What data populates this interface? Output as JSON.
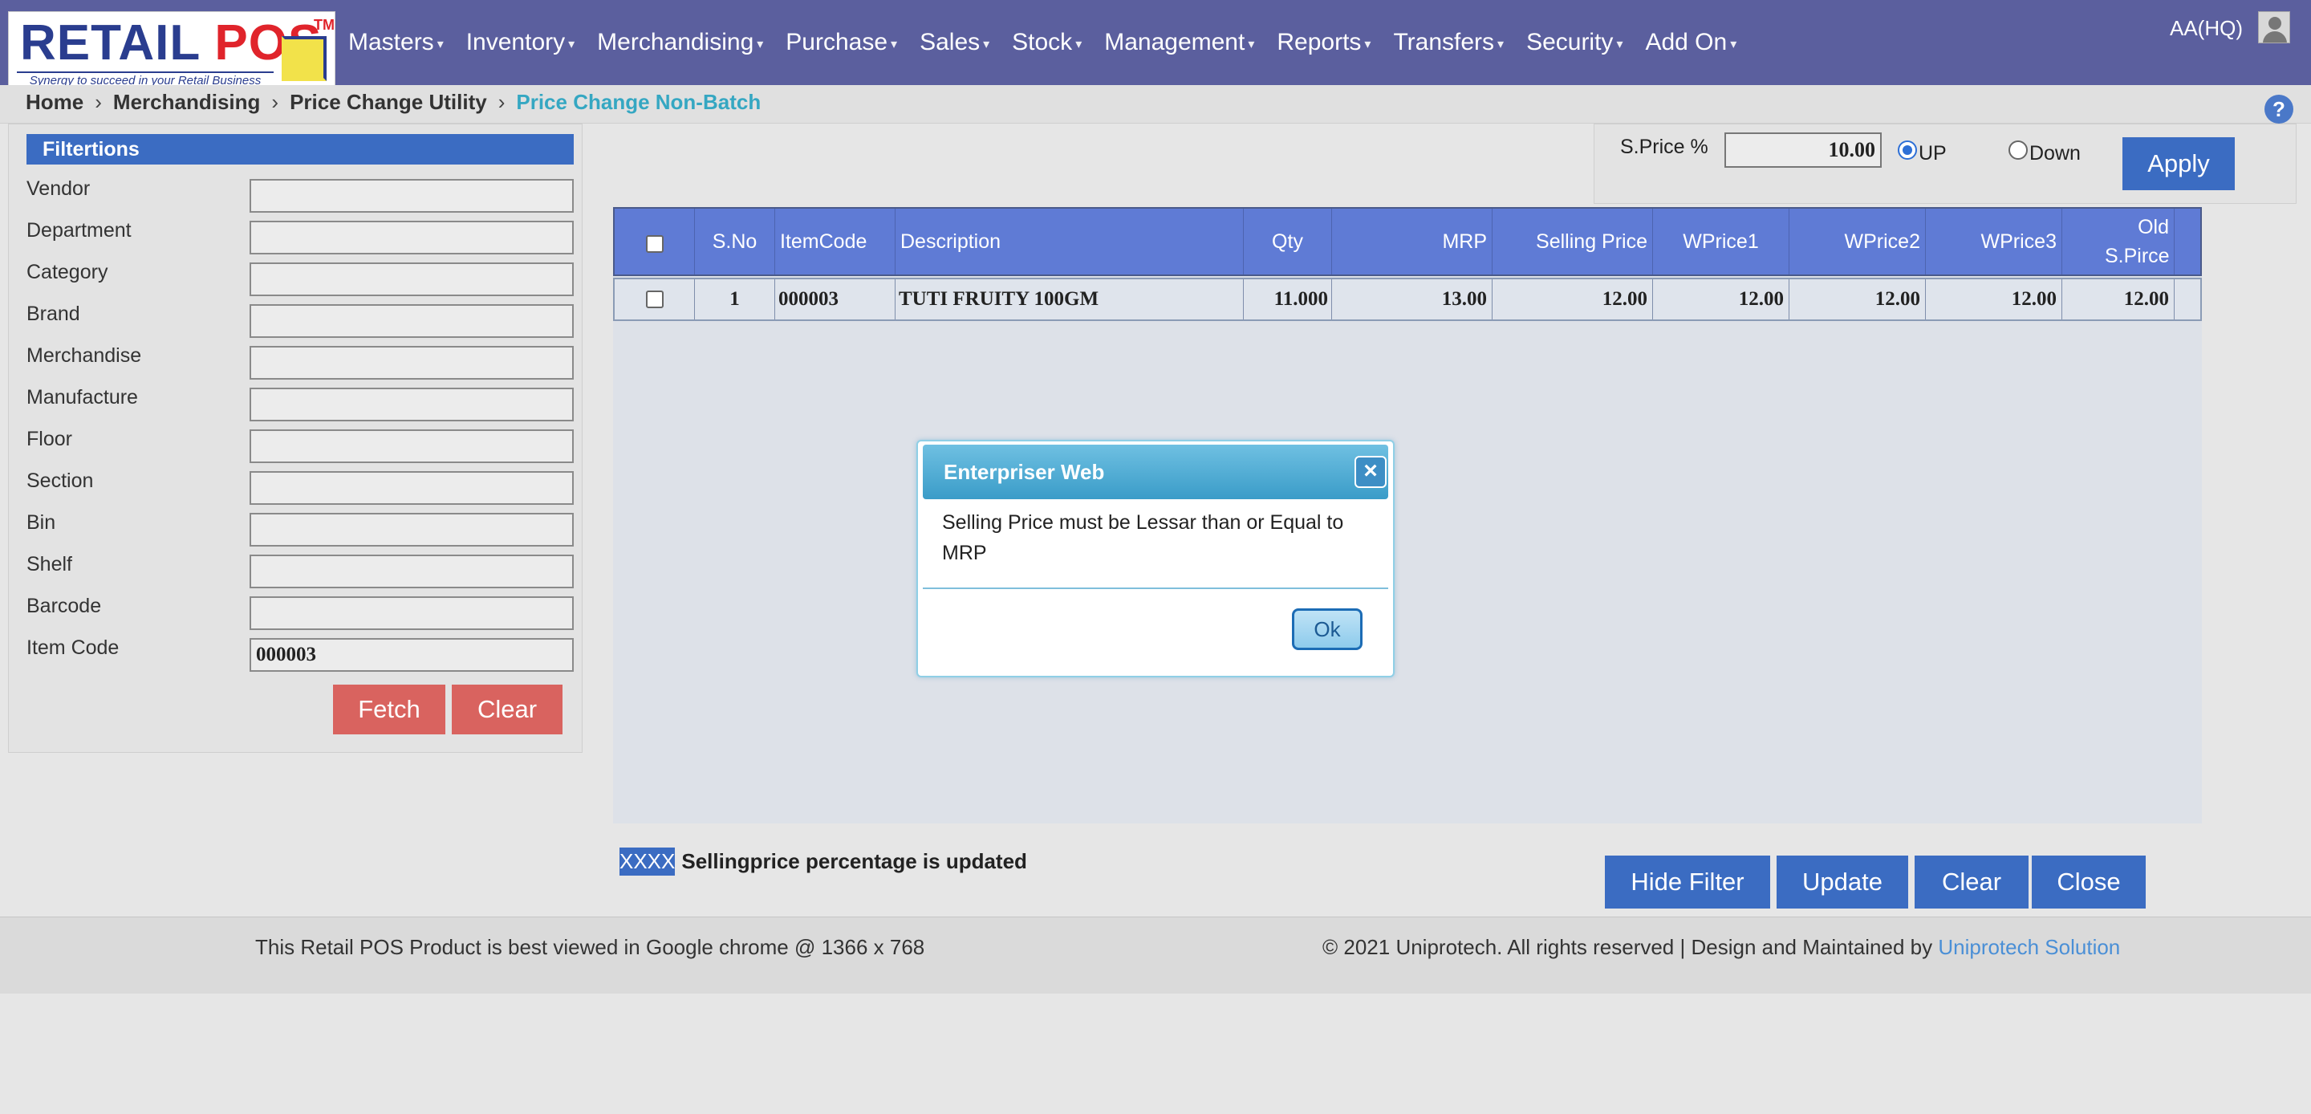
{
  "logo": {
    "text_part1": "RETAIL",
    "text_part2": "POS",
    "tm": "TM",
    "tagline": "Synergy to succeed in your Retail Business"
  },
  "nav": {
    "items": [
      "Masters",
      "Inventory",
      "Merchandising",
      "Purchase",
      "Sales",
      "Stock",
      "Management",
      "Reports",
      "Transfers",
      "Security",
      "Add On"
    ],
    "user": "AA(HQ)"
  },
  "breadcrumb": {
    "items": [
      "Home",
      "Merchandising",
      "Price Change Utility"
    ],
    "active": "Price Change Non-Batch"
  },
  "filters": {
    "title": "Filtertions",
    "fields": [
      {
        "label": "Vendor",
        "value": ""
      },
      {
        "label": "Department",
        "value": ""
      },
      {
        "label": "Category",
        "value": ""
      },
      {
        "label": "Brand",
        "value": ""
      },
      {
        "label": "Merchandise",
        "value": ""
      },
      {
        "label": "Manufacture",
        "value": ""
      },
      {
        "label": "Floor",
        "value": ""
      },
      {
        "label": "Section",
        "value": ""
      },
      {
        "label": "Bin",
        "value": ""
      },
      {
        "label": "Shelf",
        "value": ""
      },
      {
        "label": "Barcode",
        "value": ""
      },
      {
        "label": "Item Code",
        "value": "000003"
      }
    ],
    "fetch_label": "Fetch",
    "clear_label": "Clear"
  },
  "price": {
    "label": "S.Price %",
    "value": "10.00",
    "up_label": "UP",
    "down_label": "Down",
    "selected": "UP",
    "apply_label": "Apply"
  },
  "grid": {
    "headers": [
      "S.No",
      "ItemCode",
      "Description",
      "Qty",
      "MRP",
      "Selling Price",
      "WPrice1",
      "WPrice2",
      "WPrice3",
      "Old S.Pirce"
    ],
    "rows": [
      {
        "sno": "1",
        "itemcode": "000003",
        "description": "TUTI FRUITY 100GM",
        "qty": "11.000",
        "mrp": "13.00",
        "selling_price": "12.00",
        "wprice1": "12.00",
        "wprice2": "12.00",
        "wprice3": "12.00",
        "old_sprice": "12.00"
      }
    ]
  },
  "modal": {
    "title": "Enterpriser Web",
    "message": "Selling Price must be Lessar than or Equal to MRP",
    "ok_label": "Ok"
  },
  "status": {
    "highlight": "XXXX",
    "message": "Sellingprice percentage is updated"
  },
  "actions": {
    "hide_filter": "Hide Filter",
    "update": "Update",
    "clear": "Clear",
    "close": "Close"
  },
  "footer": {
    "left": "This Retail POS Product is best viewed in Google chrome @ 1366 x 768",
    "right": "© 2021 Uniprotech. All rights reserved | Design and Maintained by",
    "link": "Uniprotech Solution"
  },
  "colors": {
    "navbar": "#5b5f9e",
    "accent": "#3b6cc2",
    "danger": "#d9635f",
    "grid_header": "#5f7bd5",
    "breadcrumb_active": "#35a7c2"
  }
}
